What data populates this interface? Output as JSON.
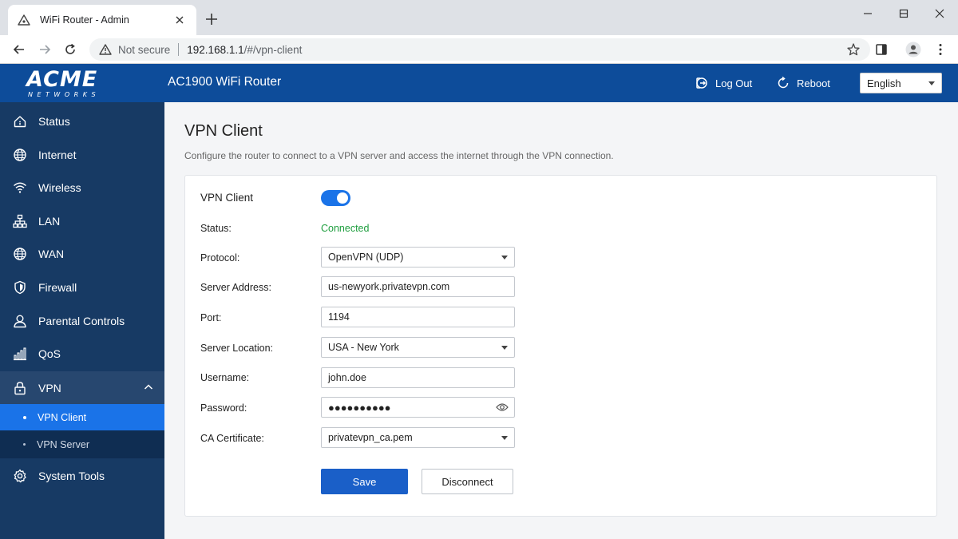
{
  "browser": {
    "tab_title": "WiFi Router - Admin",
    "security_label": "Not secure",
    "url_host": "192.168.1.1",
    "url_path": "/#/vpn-client"
  },
  "header": {
    "logo_main": "ACME",
    "logo_sub": "NETWORKS",
    "product_title": "AC1900 WiFi Router",
    "logout_label": "Log Out",
    "reboot_label": "Reboot",
    "language": "English",
    "accent_color": "#0d4c9a"
  },
  "sidebar": {
    "items": [
      {
        "label": "Status",
        "icon": "home-icon"
      },
      {
        "label": "Internet",
        "icon": "globe-icon"
      },
      {
        "label": "Wireless",
        "icon": "wifi-icon"
      },
      {
        "label": "LAN",
        "icon": "network-icon"
      },
      {
        "label": "WAN",
        "icon": "globe-icon"
      },
      {
        "label": "Firewall",
        "icon": "shield-icon"
      },
      {
        "label": "Parental Controls",
        "icon": "user-icon"
      },
      {
        "label": "QoS",
        "icon": "bar-chart-icon"
      },
      {
        "label": "VPN",
        "icon": "lock-icon"
      },
      {
        "label": "System Tools",
        "icon": "gear-icon"
      }
    ],
    "vpn_submenu": [
      {
        "label": "VPN Client",
        "active": true
      },
      {
        "label": "VPN Server",
        "active": false
      }
    ]
  },
  "page": {
    "title": "VPN Client",
    "description": "Configure the router to connect to a VPN server and access the internet through the VPN connection."
  },
  "form": {
    "vpn_client_label": "VPN Client",
    "vpn_client_enabled": true,
    "status_label": "Status:",
    "status_value": "Connected",
    "protocol_label": "Protocol:",
    "protocol_value": "OpenVPN (UDP)",
    "server_address_label": "Server Address:",
    "server_address_value": "us-newyork.privatevpn.com",
    "port_label": "Port:",
    "port_value": "1194",
    "server_location_label": "Server Location:",
    "server_location_value": "USA - New York",
    "username_label": "Username:",
    "username_value": "john.doe",
    "password_label": "Password:",
    "password_value": "●●●●●●●●●●",
    "ca_certificate_label": "CA Certificate:",
    "ca_certificate_value": "privatevpn_ca.pem",
    "save_label": "Save",
    "disconnect_label": "Disconnect",
    "status_color": "#1e9e3e",
    "primary_color": "#1a5fc8"
  }
}
